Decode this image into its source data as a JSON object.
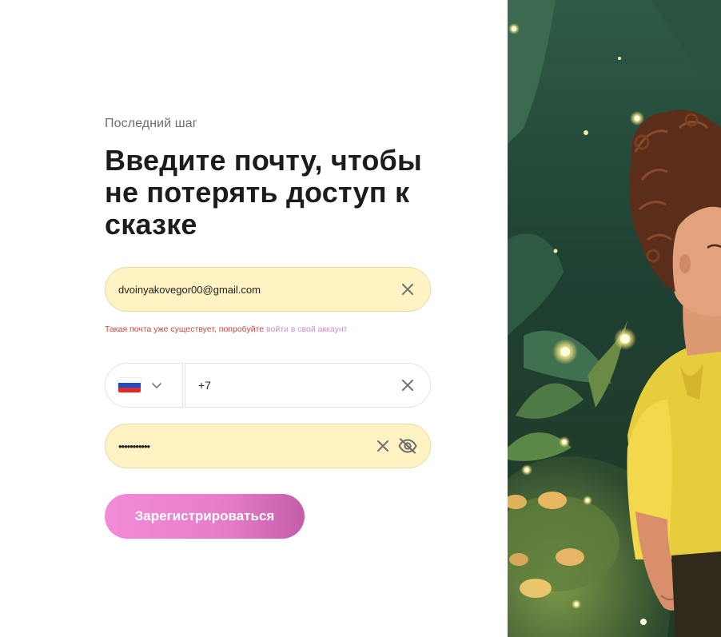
{
  "form": {
    "step_label": "Последний шаг",
    "headline": "Введите почту, чтобы не потерять доступ к сказке",
    "email": {
      "value": "dvoinyakovegor00@gmail.com",
      "clear_icon": "close-icon"
    },
    "error": {
      "text": "Такая почта уже существует, попробуйте ",
      "link": "войти в свой аккаунт"
    },
    "phone": {
      "country_flag": "russia-flag-icon",
      "chevron_icon": "chevron-down-icon",
      "value": "+7",
      "clear_icon": "close-icon"
    },
    "password": {
      "value": "•••••••••••",
      "clear_icon": "close-icon",
      "visibility_icon": "eye-off-icon"
    },
    "submit_label": "Зарегистрироваться"
  },
  "colors": {
    "input_fill": "#fff3c3",
    "error": "#d0463f",
    "link": "#d68bc6",
    "button_gradient_start": "#f38bd8",
    "button_gradient_end": "#c45da8",
    "heading": "#1c1c1c"
  }
}
